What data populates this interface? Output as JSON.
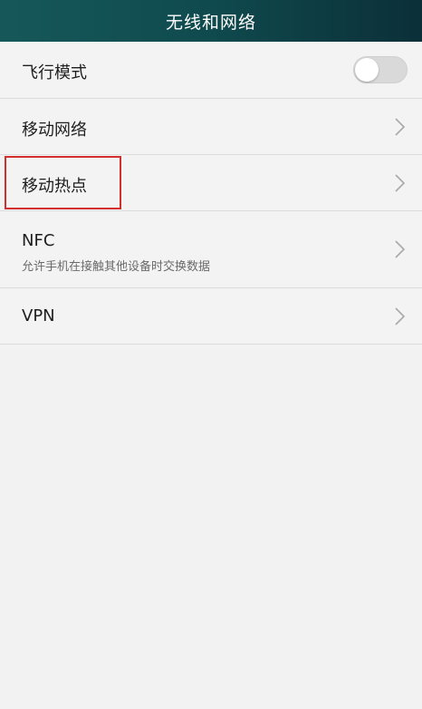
{
  "header": {
    "title": "无线和网络"
  },
  "items": [
    {
      "label": "飞行模式",
      "toggle": false
    },
    {
      "label": "移动网络",
      "icon": "chevron-right-icon"
    },
    {
      "label": "移动热点",
      "icon": "chevron-right-icon"
    },
    {
      "label": "NFC",
      "sublabel": "允许手机在接触其他设备时交换数据",
      "icon": "chevron-right-icon"
    },
    {
      "label": "VPN",
      "icon": "chevron-right-icon"
    }
  ],
  "colors": {
    "header": "#0f4a4e",
    "highlight": "#d32f2f",
    "background": "#f2f2f2"
  }
}
